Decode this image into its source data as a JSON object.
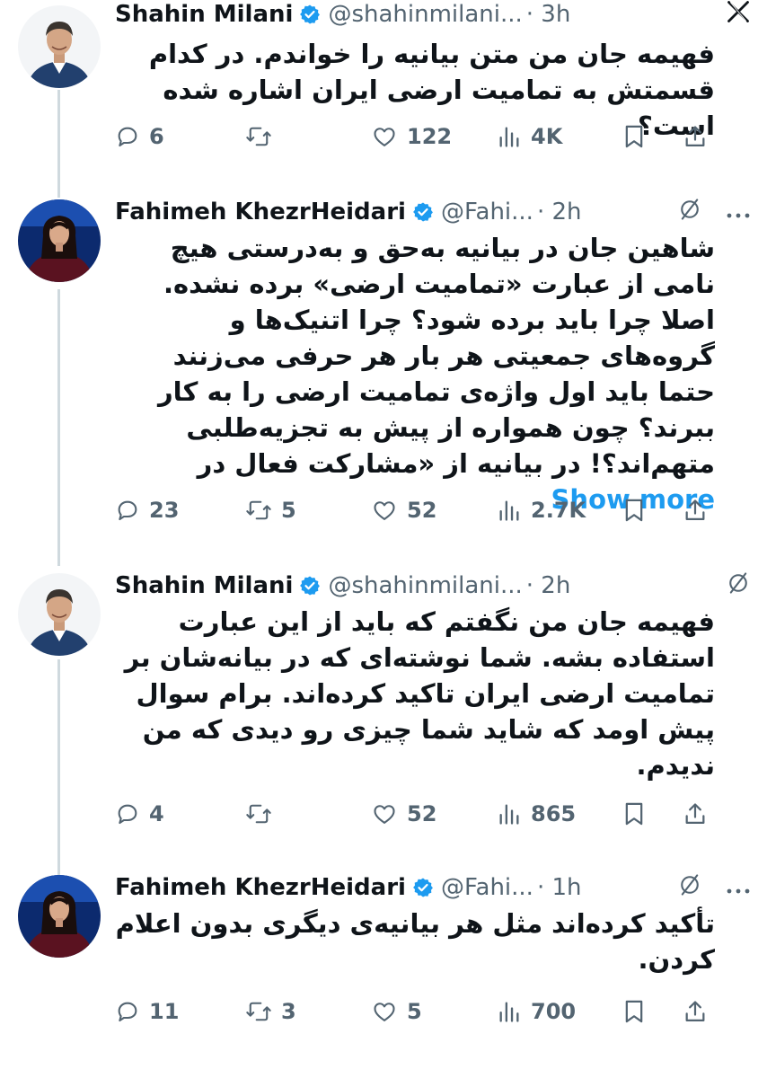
{
  "tweets": [
    {
      "name": "Shahin Milani",
      "handle": "@shahinmilani...",
      "time": "· 3h",
      "text": "فهیمه جان من متن بیانیه را خواندم. در کدام قسمتش به تمامیت ارضی ایران اشاره شده است؟",
      "show_more": "",
      "replies": "6",
      "retweets": "",
      "likes": "122",
      "views": "4K",
      "header_icon": "x-logo-icon"
    },
    {
      "name": "Fahimeh KhezrHeidari",
      "handle": "@Fahi...",
      "time": "· 2h",
      "text": "شاهین جان در بیانیه به‌حق و به‌درستی هیچ نامی از عبارت «تمامیت ارضی» برده نشده. اصلا چرا باید برده شود؟ چرا اتنیک‌ها و گروه‌های جمعیتی هر بار هر حرفی می‌زنند حتما باید اول واژه‌ی تمامیت ارضی را به کار ببرند؟ چون همواره از پیش به تجزیه‌طلبی متهم‌اند؟! در بیانیه از «مشارکت فعال در",
      "show_more": "Show more",
      "replies": "23",
      "retweets": "5",
      "likes": "52",
      "views": "2.7K",
      "header_icon": "grok-icon"
    },
    {
      "name": "Shahin Milani",
      "handle": "@shahinmilani...",
      "time": "· 2h",
      "text": "فهیمه جان من نگفتم که باید از این عبارت استفاده بشه. شما نوشته‌ای که در بیانه‌شان بر تمامیت ارضی ایران تاکید کرده‌اند. برام سوال پیش اومد که شاید شما چیزی رو دیدی که من ندیدم.",
      "show_more": "",
      "replies": "4",
      "retweets": "",
      "likes": "52",
      "views": "865",
      "header_icon": "grok-icon"
    },
    {
      "name": "Fahimeh KhezrHeidari",
      "handle": "@Fahi...",
      "time": "· 1h",
      "text": "تأکید کرده‌اند مثل هر بیانیه‌ی دیگری بدون اعلام کردن.",
      "show_more": "",
      "replies": "11",
      "retweets": "3",
      "likes": "5",
      "views": "700",
      "header_icon": "grok-icon"
    }
  ],
  "colors": {
    "text": "#0f1419",
    "secondary": "#536471",
    "link": "#1d9bf0",
    "verified": "#1d9bf0",
    "thread_line": "#cfd9de"
  }
}
